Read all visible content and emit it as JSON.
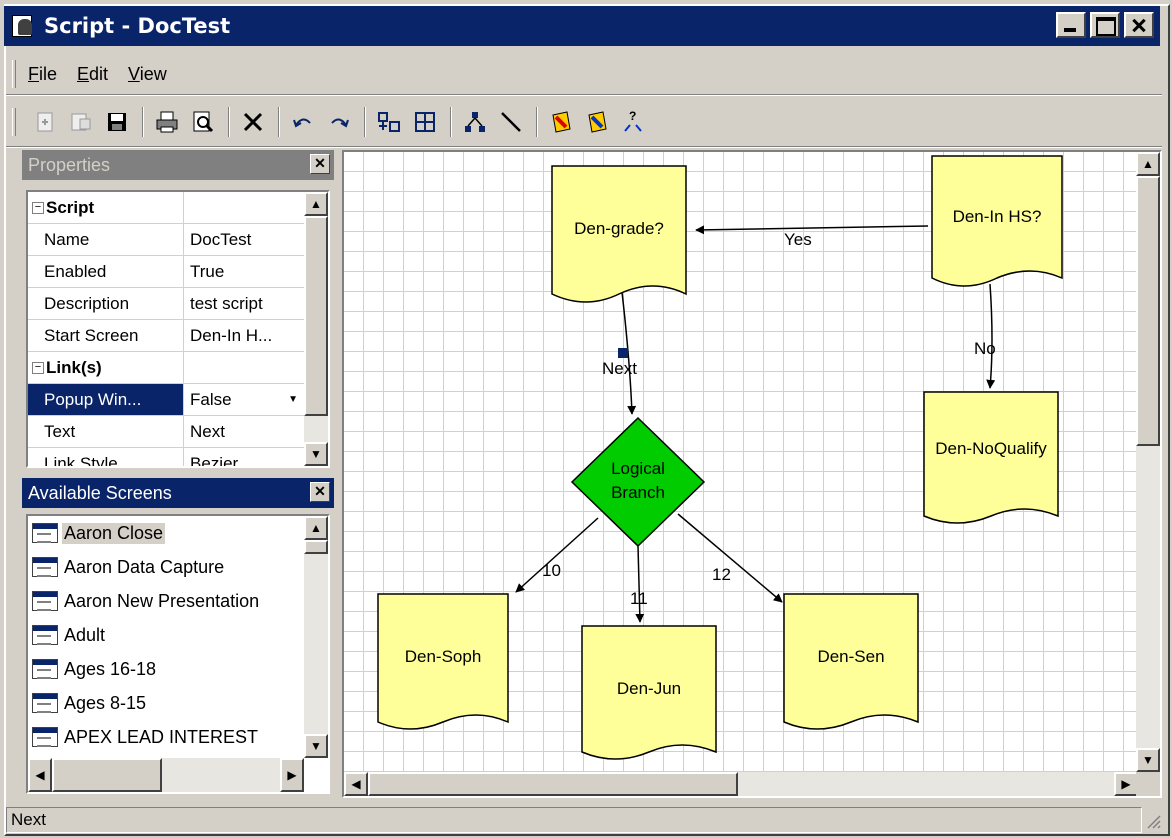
{
  "window": {
    "title": "Script - DocTest"
  },
  "menu": [
    "File",
    "Edit",
    "View"
  ],
  "toolbar": {
    "icons": [
      "new-icon",
      "properties-icon",
      "save-icon",
      "print-icon",
      "print-preview-icon",
      "delete-icon",
      "undo-icon",
      "redo-icon",
      "align-icon",
      "group-icon",
      "hierarchy-icon",
      "line-tool-icon",
      "tag-red-icon",
      "tag-blue-icon",
      "help-icon"
    ]
  },
  "properties_panel": {
    "title": "Properties",
    "rows": [
      {
        "kind": "category",
        "name": "Script",
        "value": ""
      },
      {
        "kind": "prop",
        "name": "Name",
        "value": "DocTest"
      },
      {
        "kind": "prop",
        "name": "Enabled",
        "value": "True"
      },
      {
        "kind": "prop",
        "name": "Description",
        "value": "test script"
      },
      {
        "kind": "prop",
        "name": "Start Screen",
        "value": "Den-In H..."
      },
      {
        "kind": "category",
        "name": "Link(s)",
        "value": ""
      },
      {
        "kind": "selected",
        "name": "Popup Win...",
        "value": "False"
      },
      {
        "kind": "prop",
        "name": "Text",
        "value": "Next"
      },
      {
        "kind": "prop",
        "name": "Link Style",
        "value": "Bezier"
      }
    ]
  },
  "screens_panel": {
    "title": "Available Screens",
    "items": [
      "Aaron Close",
      "Aaron Data Capture",
      "Aaron New Presentation",
      "Adult",
      "Ages 16-18",
      "Ages 8-15",
      "APEX LEAD INTEREST"
    ]
  },
  "diagram": {
    "nodes": {
      "den_grade": "Den-grade?",
      "den_in_hs": "Den-In HS?",
      "den_noqualify": "Den-NoQualify",
      "logical_branch_1": "Logical",
      "logical_branch_2": "Branch",
      "den_soph": "Den-Soph",
      "den_jun": "Den-Jun",
      "den_sen": "Den-Sen"
    },
    "links": {
      "yes": "Yes",
      "no": "No",
      "next": "Next",
      "ten": "10",
      "eleven": "11",
      "twelve": "12"
    },
    "colors": {
      "doc_fill": "#ffff99",
      "branch_fill": "#00cc00",
      "selection": "#0a246a"
    }
  },
  "status": {
    "text": "Next"
  }
}
